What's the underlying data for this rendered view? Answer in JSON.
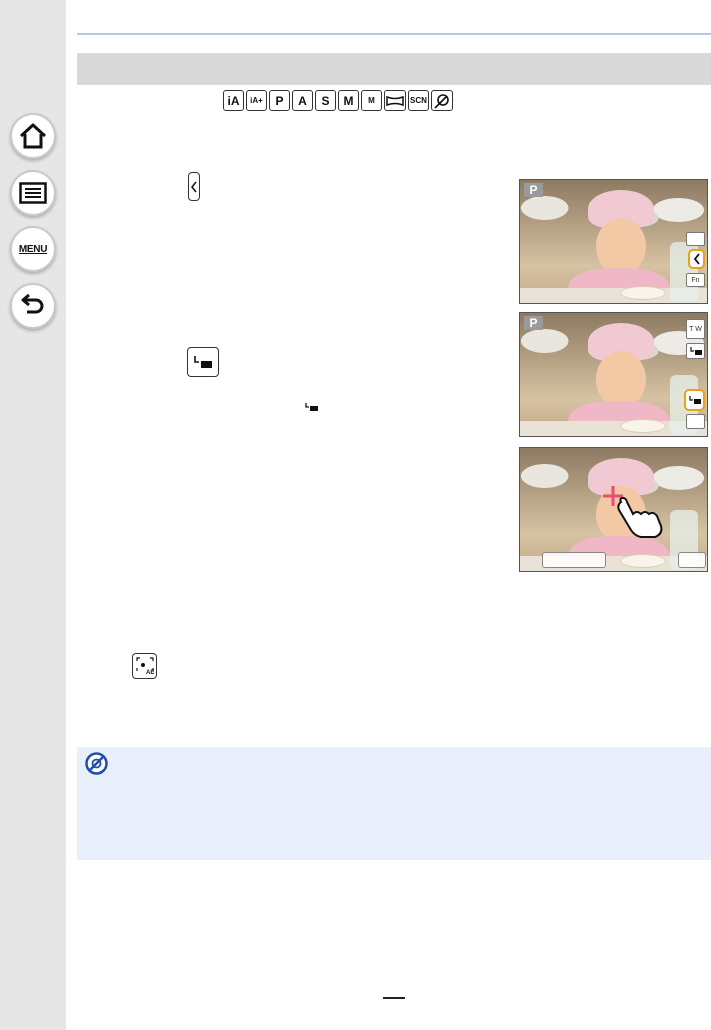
{
  "sidebar": {
    "buttons": [
      {
        "name": "home",
        "icon": "home-icon"
      },
      {
        "name": "contents",
        "icon": "list-icon"
      },
      {
        "name": "menu",
        "icon": "menu-icon",
        "label": "MENU"
      },
      {
        "name": "back",
        "icon": "back-arrow-icon"
      }
    ]
  },
  "modes": [
    "iA",
    "iA+",
    "P",
    "A",
    "S",
    "M",
    "M",
    "",
    "SCN",
    ""
  ],
  "photos": [
    {
      "mode_badge": "P",
      "side_labels": [
        "",
        "",
        "Fn"
      ]
    },
    {
      "mode_badge": "P",
      "side_labels": [
        "T W",
        "",
        "",
        ""
      ]
    },
    {
      "mode_badge": ""
    }
  ],
  "icons": [
    "tab-open-icon",
    "touch-shutter-icon",
    "touch-ae-icon",
    "prohibited-icon"
  ],
  "colors": {
    "sidebar": "#e6e6e6",
    "header_bar": "#d9d9d9",
    "rule": "#b9c7e6",
    "note_background": "#eaf0fb",
    "highlight": "#e8a11a"
  }
}
